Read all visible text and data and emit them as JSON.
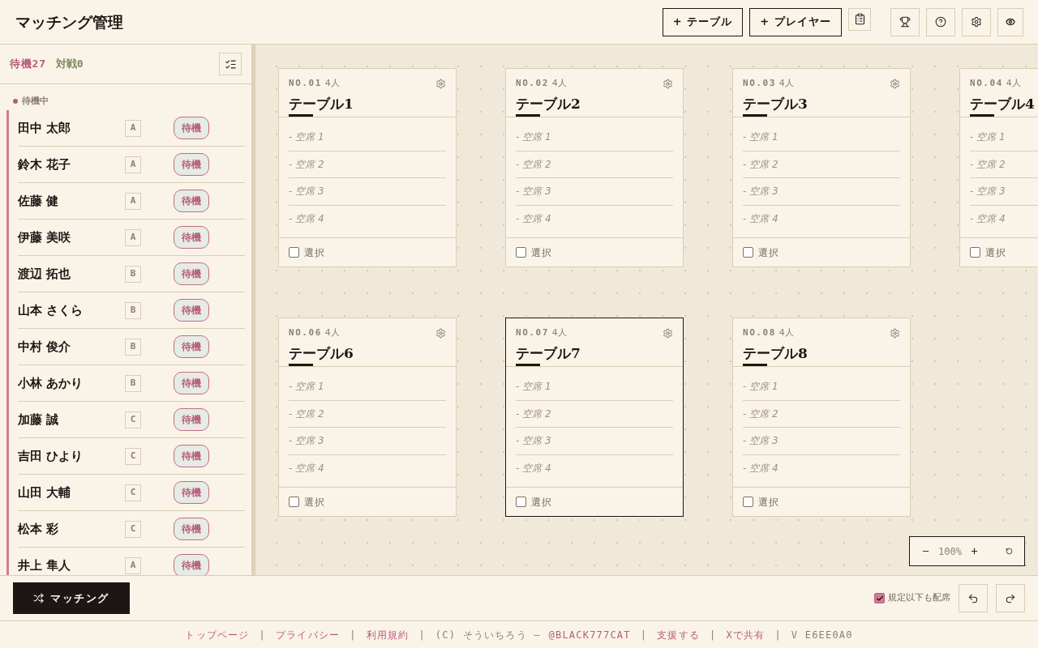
{
  "header": {
    "title": "マッチング管理",
    "buttons": [
      "+ テーブル",
      "+ プレイヤー"
    ]
  },
  "sidebar": {
    "waiting_count": "待機27",
    "playing_count": "対戦0",
    "group": {
      "label": "待機中",
      "players": [
        {
          "name": "田中 太郎",
          "grade": "A",
          "status": "待機"
        },
        {
          "name": "鈴木 花子",
          "grade": "A",
          "status": "待機"
        },
        {
          "name": "佐藤 健",
          "grade": "A",
          "status": "待機"
        },
        {
          "name": "伊藤 美咲",
          "grade": "A",
          "status": "待機"
        },
        {
          "name": "渡辺 拓也",
          "grade": "B",
          "status": "待機"
        },
        {
          "name": "山本 さくら",
          "grade": "B",
          "status": "待機"
        },
        {
          "name": "中村 俊介",
          "grade": "B",
          "status": "待機"
        },
        {
          "name": "小林 あかり",
          "grade": "B",
          "status": "待機"
        },
        {
          "name": "加藤 誠",
          "grade": "C",
          "status": "待機"
        },
        {
          "name": "吉田 ひより",
          "grade": "C",
          "status": "待機"
        },
        {
          "name": "山田 大輔",
          "grade": "C",
          "status": "待機"
        },
        {
          "name": "松本 彩",
          "grade": "C",
          "status": "待機"
        },
        {
          "name": "井上 隼人",
          "grade": "A",
          "status": "待機"
        }
      ]
    }
  },
  "canvas": {
    "table_rows": [
      [
        {
          "number": "NO.01",
          "capacity": "4人",
          "name": "テーブル1",
          "seats": [
            "- 空席 1",
            "- 空席 2",
            "- 空席 3",
            "- 空席 4"
          ],
          "select_label": "選択",
          "checked": false,
          "selected": false
        },
        {
          "number": "NO.02",
          "capacity": "4人",
          "name": "テーブル2",
          "seats": [
            "- 空席 1",
            "- 空席 2",
            "- 空席 3",
            "- 空席 4"
          ],
          "select_label": "選択",
          "checked": false,
          "selected": false
        },
        {
          "number": "NO.03",
          "capacity": "4人",
          "name": "テーブル3",
          "seats": [
            "- 空席 1",
            "- 空席 2",
            "- 空席 3",
            "- 空席 4"
          ],
          "select_label": "選択",
          "checked": false,
          "selected": false
        },
        {
          "number": "NO.04",
          "capacity": "4人",
          "name": "テーブル4",
          "seats": [
            "- 空席 1",
            "- 空席 2",
            "- 空席 3",
            "- 空席 4"
          ],
          "select_label": "選択",
          "checked": false,
          "selected": false
        }
      ],
      [
        {
          "number": "NO.06",
          "capacity": "4人",
          "name": "テーブル6",
          "seats": [
            "- 空席 1",
            "- 空席 2",
            "- 空席 3",
            "- 空席 4"
          ],
          "select_label": "選択",
          "checked": false,
          "selected": false
        },
        {
          "number": "NO.07",
          "capacity": "4人",
          "name": "テーブル7",
          "seats": [
            "- 空席 1",
            "- 空席 2",
            "- 空席 3",
            "- 空席 4"
          ],
          "select_label": "選択",
          "checked": false,
          "selected": true
        },
        {
          "number": "NO.08",
          "capacity": "4人",
          "name": "テーブル8",
          "seats": [
            "- 空席 1",
            "- 空席 2",
            "- 空席 3",
            "- 空席 4"
          ],
          "select_label": "選択",
          "checked": false,
          "selected": false
        }
      ]
    ],
    "zoom_level": "100%"
  },
  "bottom_bar": {
    "match_button": "マッチング",
    "allow_below": {
      "label": "規定以下も配席",
      "checked": true
    }
  },
  "footer": [
    {
      "kind": "link",
      "text": "トップページ"
    },
    {
      "kind": "separator",
      "text": "|"
    },
    {
      "kind": "link",
      "text": "プライバシー"
    },
    {
      "kind": "separator",
      "text": "|"
    },
    {
      "kind": "link",
      "text": "利用規約"
    },
    {
      "kind": "separator",
      "text": "|"
    },
    {
      "kind": "text",
      "text": "(C) そういちろう —"
    },
    {
      "kind": "link",
      "text": "@BLACK777CAT"
    },
    {
      "kind": "separator",
      "text": "|"
    },
    {
      "kind": "link",
      "text": "支援する"
    },
    {
      "kind": "separator",
      "text": "|"
    },
    {
      "kind": "link",
      "text": "Xで共有"
    },
    {
      "kind": "separator",
      "text": "|"
    },
    {
      "kind": "text",
      "text": "V E6EE0A0"
    }
  ]
}
